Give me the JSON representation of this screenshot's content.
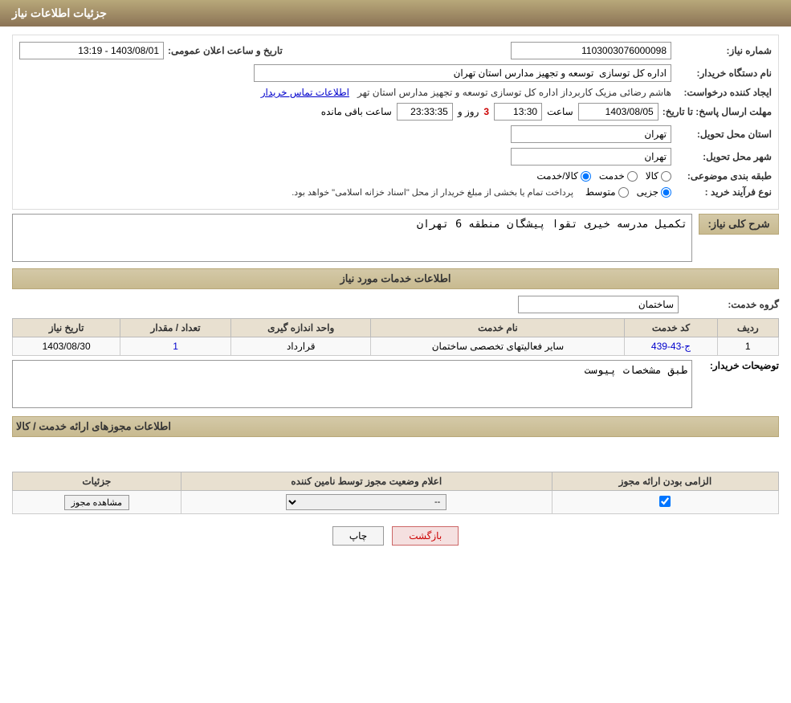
{
  "header": {
    "title": "جزئیات اطلاعات نیاز"
  },
  "page_title": "جزئیات اطلاعات نیاز",
  "fields": {
    "need_number_label": "شماره نیاز:",
    "need_number_value": "1103003076000098",
    "buyer_org_label": "نام دستگاه خریدار:",
    "buyer_org_value": "اداره کل توسازی  توسعه و تجهیز مدارس استان تهران",
    "requester_label": "ایجاد کننده درخواست:",
    "requester_value": "هاشم رضائی مزیک کاربرداز اداره کل توسازی  توسعه و تجهیز مدارس استان تهر",
    "contact_link": "اطلاعات تماس خریدار",
    "response_deadline_label": "مهلت ارسال پاسخ: تا تاریخ:",
    "response_date": "1403/08/05",
    "response_time_label": "ساعت",
    "response_time": "13:30",
    "days_remaining_label": "روز و",
    "days_remaining": "3",
    "hours_remaining": "23:33:35",
    "hours_remaining_label": "ساعت باقی مانده",
    "announce_datetime_label": "تاریخ و ساعت اعلان عمومی:",
    "announce_datetime_value": "1403/08/01 - 13:19",
    "province_label": "استان محل تحویل:",
    "province_value": "تهران",
    "city_label": "شهر محل تحویل:",
    "city_value": "تهران",
    "category_label": "طبقه بندی موضوعی:",
    "category_options": [
      "کالا",
      "خدمت",
      "کالا/خدمت"
    ],
    "category_selected": "کالا",
    "purchase_type_label": "نوع فرآیند خرید :",
    "purchase_type_options": [
      "جزیی",
      "متوسط"
    ],
    "purchase_type_note": "پرداخت تمام یا بخشی از مبلغ خریدار از محل \"اسناد خزانه اسلامی\" خواهد بود.",
    "need_description_label": "شرح کلی نیاز:",
    "need_description_value": "تکمیل مدرسه خیری تقوا پیشگان منطقه 6 تهران"
  },
  "services_section": {
    "title": "اطلاعات خدمات مورد نیاز",
    "service_group_label": "گروه خدمت:",
    "service_group_value": "ساختمان",
    "table": {
      "columns": [
        "ردیف",
        "کد خدمت",
        "نام خدمت",
        "واحد اندازه گیری",
        "تعداد / مقدار",
        "تاریخ نیاز"
      ],
      "rows": [
        {
          "row_num": "1",
          "code": "ج-43-439",
          "name": "سایر فعالیتهای تخصصی ساختمان",
          "unit": "قرارداد",
          "quantity": "1",
          "date": "1403/08/30"
        }
      ]
    }
  },
  "buyer_description_label": "توضیحات خریدار:",
  "buyer_description_value": "طبق مشخصات پیوست",
  "licenses_section": {
    "title": "اطلاعات مجوزهای ارائه خدمت / کالا",
    "table": {
      "columns": [
        "الزامی بودن ارائه مجوز",
        "اعلام وضعیت مجوز توسط نامین کننده",
        "جزئیات"
      ],
      "rows": [
        {
          "required": true,
          "status": "--",
          "details_btn": "مشاهده مجوز"
        }
      ]
    }
  },
  "buttons": {
    "print": "چاپ",
    "back": "بازگشت"
  }
}
